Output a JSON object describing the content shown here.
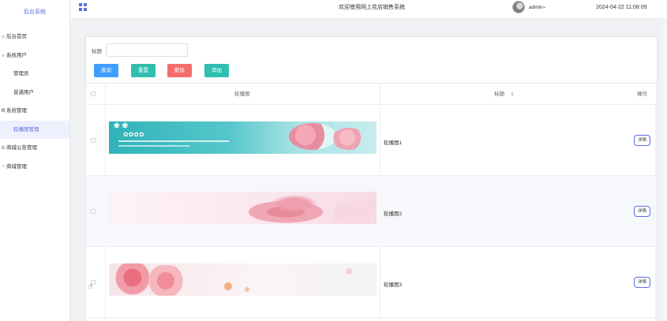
{
  "sidebar": {
    "brand": "后台系统",
    "items": [
      {
        "label": "后台首页",
        "icon": "home-icon"
      },
      {
        "label": "系统用户",
        "icon": "user-icon"
      },
      {
        "label": "管理员",
        "sub": true
      },
      {
        "label": "普通用户",
        "sub": true
      },
      {
        "label": "系统管理",
        "icon": "settings-icon"
      },
      {
        "label": "轮播图管理",
        "sub": true,
        "active": true
      },
      {
        "label": "商城公告管理",
        "icon": "notice-icon"
      },
      {
        "label": "商城管理",
        "icon": "grid-icon"
      }
    ]
  },
  "header": {
    "welcome": "欢迎使用网上花店销售系统",
    "user": "admin",
    "datetime": "2024-04-22 11:08:09"
  },
  "search": {
    "label": "标题",
    "value": "",
    "placeholder": ""
  },
  "buttons": {
    "search": "查询",
    "reset": "重置",
    "delete": "删除",
    "add": "添加"
  },
  "table": {
    "columns": [
      "轮播图",
      "标题",
      "操作"
    ],
    "sort_icon": "sort-icon",
    "rows": [
      {
        "title": "轮播图1",
        "action": "详情"
      },
      {
        "title": "轮播图2",
        "action": "详情"
      },
      {
        "title": "轮播图3",
        "action": "详情"
      }
    ]
  },
  "colors": {
    "accent": "#5b6ee1",
    "primary": "#409eff",
    "teal": "#2ebfb0",
    "danger": "#f56c6c"
  }
}
